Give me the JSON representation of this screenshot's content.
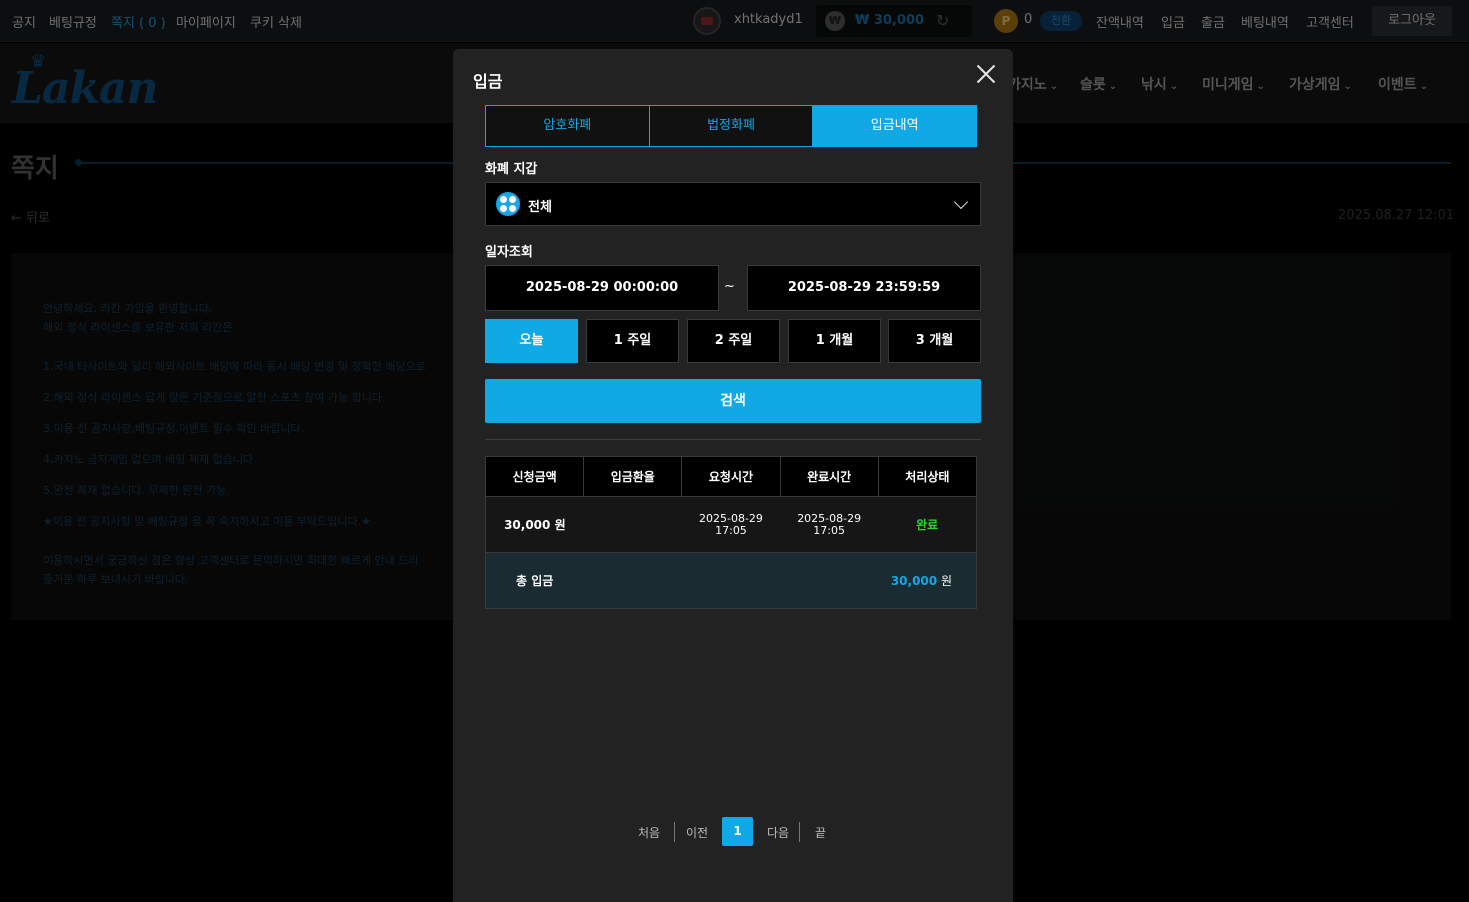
{
  "topbar": {
    "links": [
      "공지",
      "베팅규정",
      "쪽지 ( 0 )",
      "마이페이지",
      "쿠키 삭제"
    ],
    "username": "xhtkadyd1",
    "balance": "₩ 30,000",
    "points": "0",
    "convert": "전환",
    "menu": [
      "잔액내역",
      "입금",
      "출금",
      "베팅내역",
      "고객센터"
    ],
    "logout": "로그아웃"
  },
  "nav": {
    "logo": "Lakan",
    "items": [
      "카지노",
      "슬롯",
      "낚시",
      "미니게임",
      "가상게임",
      "이벤트"
    ]
  },
  "page": {
    "title": "쪽지",
    "back": "← 뒤로",
    "date": "2025.08.27 12:01",
    "lines": [
      "안녕하세요, 라칸 가입을 환영합니다.",
      "해외 정식 라이센스를 보유한 저희 라칸은",
      "1.국내 타사이트와 달리 해외사이트 배당에 따라 동시 배당 변경 및 정확한 배당으로",
      "2.해외 정식 라이센스 답게 많은 기준점으로 알찬 스포츠 참여 가능 합니다.",
      "3.이용 전 공지사항,베팅규정,이벤트 필수 확인 바랍니다.",
      "4.카지노 금지게임 없으며 베팅 제재 없습니다",
      "5.완전 제재 없습니다. 무제한 완전 가능.",
      "★이용 전 공지사항 및 베팅규정 을 꼭 숙지하시고 이용 부탁드립니다.★",
      "이용하시면서 궁금하신 점은 항상 고객센터로 문의하시면 최대한 빠르게 안내 드리",
      "즐거운 하루 보내시기 바랍니다."
    ]
  },
  "modal": {
    "title": "입금",
    "tabs": [
      "암호화폐",
      "법정화폐",
      "입금내역"
    ],
    "wallet_label": "화폐 지갑",
    "wallet_value": "전체",
    "date_label": "일자조회",
    "date_from": "2025-08-29 00:00:00",
    "date_sep": "~",
    "date_to": "2025-08-29 23:59:59",
    "periods": [
      "오늘",
      "1 주일",
      "2 주일",
      "1 개월",
      "3 개월"
    ],
    "search": "검색",
    "table": {
      "headers": [
        "신청금액",
        "입금환율",
        "요청시간",
        "완료시간",
        "처리상태"
      ],
      "row": {
        "amount": "30,000 원",
        "rate": "",
        "request_date": "2025-08-29",
        "request_time": "17:05",
        "done_date": "2025-08-29",
        "done_time": "17:05",
        "status": "완료"
      },
      "total_label": "총 입금",
      "total_value": "30,000",
      "total_unit": " 원"
    },
    "pager": {
      "first": "처음",
      "prev": "이전",
      "current": "1",
      "next": "다음",
      "last": "끝"
    }
  },
  "colors": {
    "accent": "#11a8e6",
    "status_done": "#2fd42f",
    "modal_bg": "#222222"
  }
}
